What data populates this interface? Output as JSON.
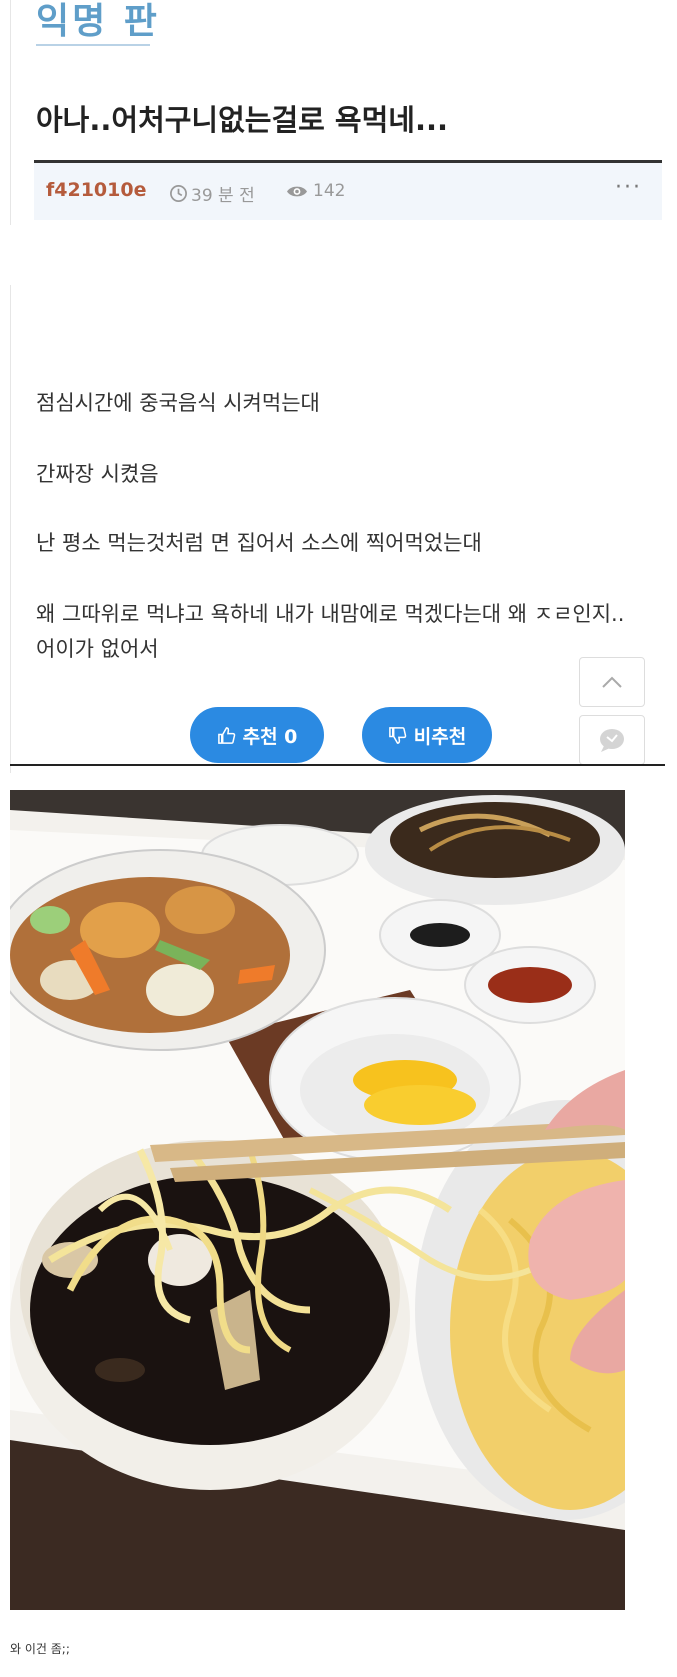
{
  "board": {
    "name": "익명 판"
  },
  "post": {
    "title": "아나..어처구니없는걸로 욕먹네...",
    "author": "f421010e",
    "time": "39 분 전",
    "views": "142",
    "more": "···",
    "body_lines": [
      "점심시간에 중국음식 시켜먹는대",
      "간짜장 시켰음",
      "난 평소 먹는것처럼 면 집어서 소스에 찍어먹었는대",
      "왜 그따위로 먹냐고 욕하네 내가 내맘에로 먹겠다는대 왜 ㅈㄹ인지..",
      "어이가 없어서"
    ],
    "recommend_label": "추천 0",
    "not_recommend_label": "비추천"
  },
  "caption": "와 이건 좀;;",
  "colors": {
    "board_name": "#5f9ec9",
    "author": "#b55b3c",
    "vote_button": "#2b8ae2",
    "meta_bg": "#f2f6fb"
  },
  "icons": {
    "clock": "clock-icon",
    "eye": "eye-icon",
    "thumbs_up": "thumbs-up-icon",
    "thumbs_down": "thumbs-down-icon",
    "up": "chevron-up-icon",
    "chat": "chat-bubble-icon"
  }
}
